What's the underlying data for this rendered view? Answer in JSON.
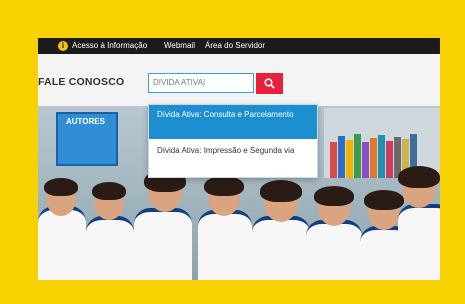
{
  "topbar": {
    "acesso_label": "Acesso à Informação",
    "webmail_label": "Webmail",
    "servidor_label": "Área do Servidor"
  },
  "header": {
    "fale_label": "FALE CONOSCO",
    "search_value": "DIVIDA ATIVA|"
  },
  "photo": {
    "board_label": "AUTORES"
  },
  "dropdown": {
    "options": [
      {
        "label": "Dívida Ativa: Consulta e Parcelamento"
      },
      {
        "label": "Dívida Ativa: Impressão e Segunda via"
      }
    ]
  },
  "colors": {
    "accent_yellow": "#f7d100",
    "search_button": "#e8213b",
    "highlight": "#1c8fd1"
  }
}
